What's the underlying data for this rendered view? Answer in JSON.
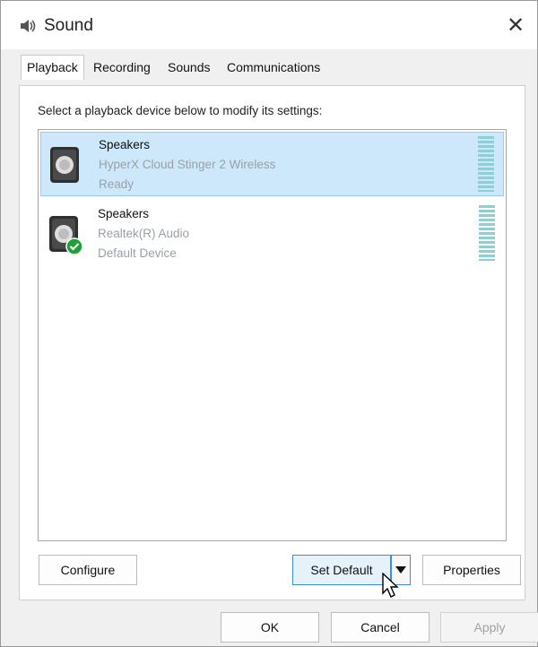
{
  "window": {
    "title": "Sound",
    "close_glyph": "✕"
  },
  "tabs": [
    {
      "label": "Playback",
      "selected": true
    },
    {
      "label": "Recording",
      "selected": false
    },
    {
      "label": "Sounds",
      "selected": false
    },
    {
      "label": "Communications",
      "selected": false
    }
  ],
  "instruction": "Select a playback device below to modify its settings:",
  "devices": [
    {
      "name": "Speakers",
      "description": "HyperX Cloud Stinger 2 Wireless",
      "status": "Ready",
      "selected": true,
      "default_badge": false
    },
    {
      "name": "Speakers",
      "description": "Realtek(R) Audio",
      "status": "Default Device",
      "selected": false,
      "default_badge": true
    }
  ],
  "buttons": {
    "configure": "Configure",
    "set_default": "Set Default",
    "properties": "Properties",
    "ok": "OK",
    "cancel": "Cancel",
    "apply": "Apply"
  },
  "colors": {
    "selection_bg": "#cde8fb",
    "focus_border": "#3c8ed8",
    "default_badge": "#21a038"
  }
}
